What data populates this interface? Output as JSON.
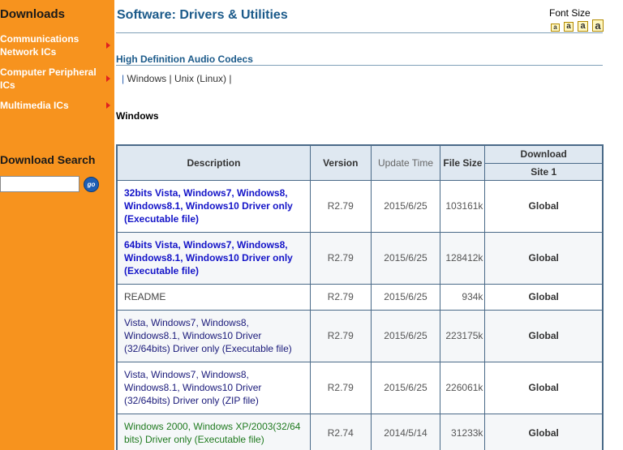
{
  "sidebar": {
    "title": "Downloads",
    "items": [
      {
        "label": "Communications Network ICs"
      },
      {
        "label": "Computer Peripheral ICs"
      },
      {
        "label": "Multimedia ICs"
      }
    ],
    "search_title": "Download Search",
    "search_value": "",
    "go_label": "go"
  },
  "header": {
    "title": "Software: Drivers & Utilities",
    "font_size_label": "Font Size",
    "font_size_buttons": [
      "a",
      "a",
      "a",
      "a"
    ]
  },
  "section": {
    "title": "High Definition Audio Codecs",
    "os_links": [
      "Windows",
      "Unix (Linux)"
    ],
    "separator": "|",
    "subsection": "Windows"
  },
  "table": {
    "headers": {
      "description": "Description",
      "version": "Version",
      "update_time": "Update Time",
      "file_size": "File Size",
      "download": "Download",
      "site": "Site 1"
    },
    "rows": [
      {
        "description": "32bits Vista, Windows7, Windows8, Windows8.1, Windows10 Driver only (Executable file)",
        "version": "R2.79",
        "update_time": "2015/6/25",
        "file_size": "103161k",
        "download": "Global",
        "style": "blue-bold"
      },
      {
        "description": "64bits Vista, Windows7, Windows8, Windows8.1, Windows10 Driver only (Executable file)",
        "version": "R2.79",
        "update_time": "2015/6/25",
        "file_size": "128412k",
        "download": "Global",
        "style": "blue-bold"
      },
      {
        "description": "README",
        "version": "R2.79",
        "update_time": "2015/6/25",
        "file_size": "934k",
        "download": "Global",
        "style": "gray"
      },
      {
        "description": "Vista, Windows7, Windows8, Windows8.1, Windows10 Driver (32/64bits) Driver only (Executable file)",
        "version": "R2.79",
        "update_time": "2015/6/25",
        "file_size": "223175k",
        "download": "Global",
        "style": "navy"
      },
      {
        "description": "Vista, Windows7, Windows8, Windows8.1, Windows10 Driver (32/64bits) Driver only (ZIP file)",
        "version": "R2.79",
        "update_time": "2015/6/25",
        "file_size": "226061k",
        "download": "Global",
        "style": "navy"
      },
      {
        "description": "Windows 2000, Windows XP/2003(32/64 bits) Driver only (Executable file)",
        "version": "R2.74",
        "update_time": "2014/5/14",
        "file_size": "31233k",
        "download": "Global",
        "style": "green"
      }
    ]
  },
  "colors": {
    "sidebar_bg": "#f7931e",
    "title_blue": "#1b5a8a",
    "table_border": "#4a6a88",
    "header_bg": "#dfe8f1",
    "link_blue": "#1414c8",
    "link_navy": "#1a1a7a",
    "link_green": "#1f7a1f"
  }
}
